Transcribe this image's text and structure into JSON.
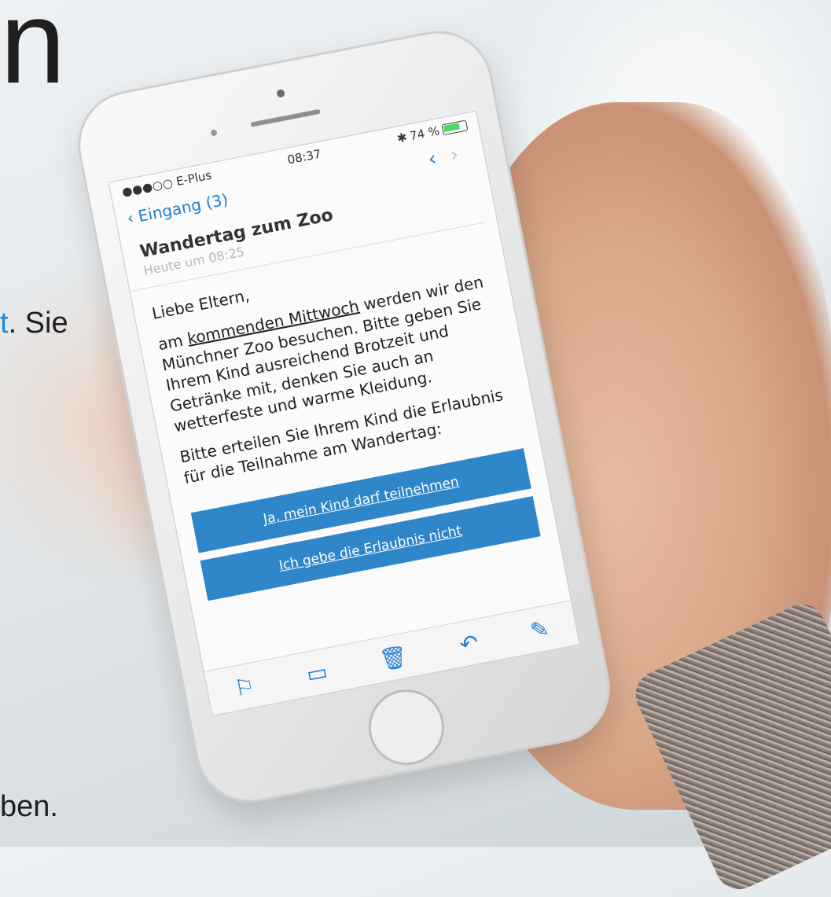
{
  "page_fragments": {
    "top_letter": "n",
    "line_link": "t",
    "line_after": ". Sie",
    "bottom_text": "ben."
  },
  "phone": {
    "status_bar": {
      "carrier": "●●●○○ E-Plus",
      "time": "08:37",
      "battery": "74 %"
    },
    "nav": {
      "back_label": "Eingang (3)"
    },
    "email": {
      "subject": "Wandertag zum Zoo",
      "timestamp": "Heute um 08:25",
      "greeting": "Liebe Eltern,",
      "para1_prefix": "am ",
      "para1_link": "kommenden Mittwoch",
      "para1_rest": " werden wir den Münchner Zoo besuchen. Bitte geben Sie Ihrem Kind ausreichend Brotzeit und Getränke mit, denken Sie auch an wetterfeste und warme Kleidung.",
      "para2": "Bitte erteilen Sie Ihrem Kind die Erlaubnis für die Teilnahme am Wandertag:",
      "btn_yes": "Ja, mein Kind darf teilnehmen",
      "btn_no": "Ich gebe die Erlaubnis nicht"
    },
    "toolbar_icons": [
      "flag-icon",
      "folder-icon",
      "trash-icon",
      "reply-icon",
      "compose-icon"
    ]
  },
  "colors": {
    "accent": "#1a7fd4",
    "button": "#2f86c9",
    "link_fragment": "#1e88e5"
  }
}
